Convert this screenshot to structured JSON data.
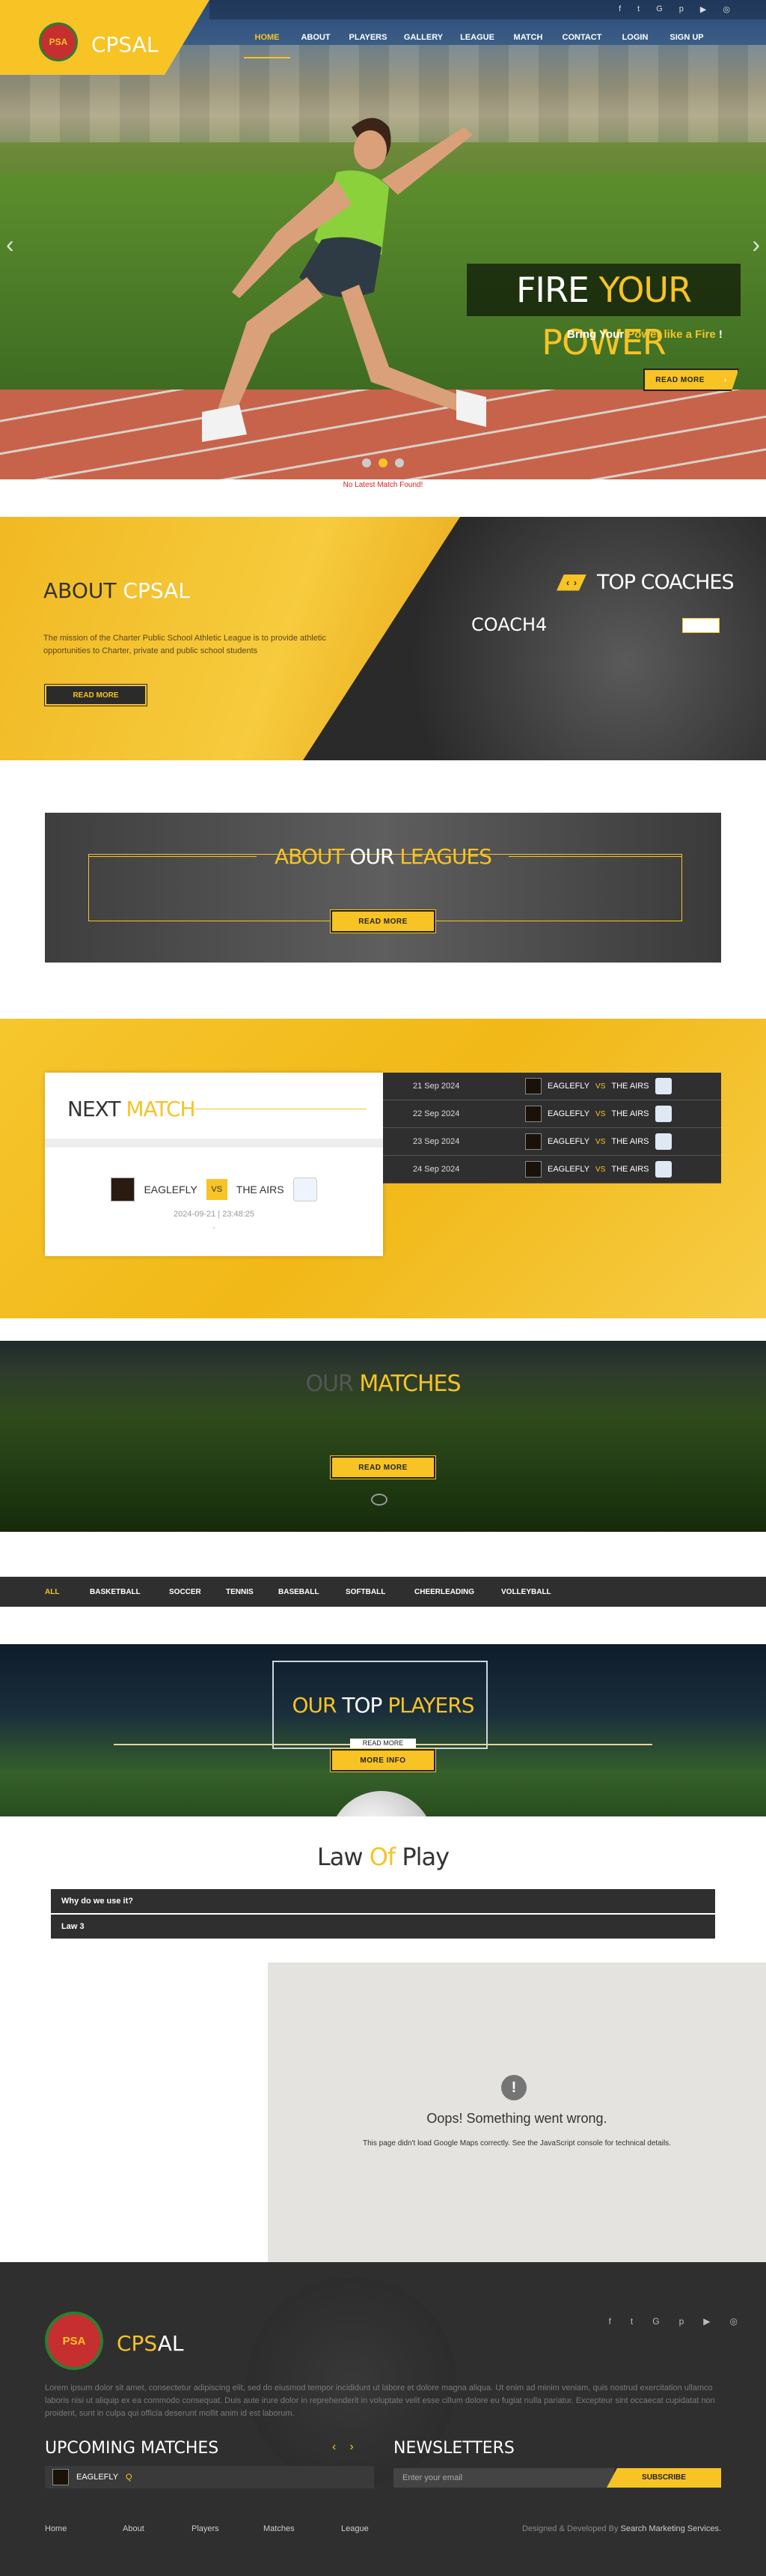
{
  "brand": {
    "name": "CPSAL",
    "logo_text": "PSA"
  },
  "topbar": {
    "social": [
      {
        "icon": "facebook-icon",
        "glyph": "f"
      },
      {
        "icon": "twitter-icon",
        "glyph": "t"
      },
      {
        "icon": "google-icon",
        "glyph": "G"
      },
      {
        "icon": "pinterest-icon",
        "glyph": "p"
      },
      {
        "icon": "youtube-icon",
        "glyph": "▶"
      },
      {
        "icon": "instagram-icon",
        "glyph": "◎"
      }
    ]
  },
  "nav": [
    {
      "label": "HOME",
      "active": true
    },
    {
      "label": "ABOUT"
    },
    {
      "label": "PLAYERS"
    },
    {
      "label": "GALLERY"
    },
    {
      "label": "LEAGUE"
    },
    {
      "label": "MATCH"
    },
    {
      "label": "CONTACT"
    },
    {
      "label": "LOGIN"
    },
    {
      "label": "SIGN UP"
    }
  ],
  "hero": {
    "title_white": "FIRE ",
    "title_yellow": "YOUR POWER",
    "sub_a": "Bring Your ",
    "sub_b": "Power like a Fire",
    "sub_c": " !",
    "button": "READ MORE",
    "prev": "‹",
    "next": "›",
    "no_match": "No Latest Match Found!"
  },
  "about": {
    "title_a": "ABOUT ",
    "title_b": "CPSAL",
    "text": "The mission of the Charter Public School Athletic League is to provide athletic opportunities to Charter, private and public school students",
    "button": "READ MORE"
  },
  "coaches": {
    "title": "TOP COACHES",
    "prev": "‹",
    "next": "›",
    "name": "COACH4"
  },
  "leagues": {
    "title_a": "ABOUT ",
    "title_b": "OUR ",
    "title_c": "LEAGUES",
    "button": "READ MORE"
  },
  "next_match": {
    "title_a": "NEXT ",
    "title_b": "MATCH",
    "team1": "EAGLEFLY",
    "vs": "VS",
    "team2": "THE AIRS",
    "date": "2024-09-21 | 23:48:25",
    "score": "-"
  },
  "schedule": [
    {
      "date": "21 Sep 2024",
      "team1": "EAGLEFLY",
      "vs": "VS",
      "team2": "THE AIRS"
    },
    {
      "date": "22 Sep 2024",
      "team1": "EAGLEFLY",
      "vs": "VS",
      "team2": "THE AIRS"
    },
    {
      "date": "23 Sep 2024",
      "team1": "EAGLEFLY",
      "vs": "VS",
      "team2": "THE AIRS"
    },
    {
      "date": "24 Sep 2024",
      "team1": "EAGLEFLY",
      "vs": "VS",
      "team2": "THE AIRS"
    }
  ],
  "matches": {
    "title_a": "OUR ",
    "title_b": "MATCHES",
    "button": "READ MORE"
  },
  "filters": [
    "ALL",
    "BASKETBALL",
    "SOCCER",
    "TENNIS",
    "BASEBALL",
    "SOFTBALL",
    "CHEERLEADING",
    "VOLLEYBALL"
  ],
  "players": {
    "title_a": "OUR ",
    "title_b": "TOP ",
    "title_c": "PLAYERS",
    "read_more": "READ MORE",
    "more_info": "MORE INFO"
  },
  "law": {
    "title_a": "Law ",
    "title_b": "Of ",
    "title_c": "Play",
    "items": [
      "Why do we use it?",
      "Law 3"
    ]
  },
  "map": {
    "icon": "!",
    "error": "Oops! Something went wrong.",
    "sub": "This page didn't load Google Maps correctly. See the JavaScript console for technical details."
  },
  "footer": {
    "name_a": "CPS",
    "name_b": "AL",
    "lorem": "Lorem ipsum dolor sit amet, consectetur adipiscing elit, sed do eiusmod tempor incididunt ut labore et dolore magna aliqua. Ut enim ad minim veniam, quis nostrud exercitation ullamco laboris nisi ut aliquip ex ea commodo consequat. Duis aute irure dolor in reprehenderit in voluptate velit esse cillum dolore eu fugiat nulla pariatur. Excepteur sint occaecat cupidatat non proident, sunt in culpa qui officia deserunt mollit anim id est laborum.",
    "upcoming_title": "UPCOMING MATCHES",
    "upcoming_prev": "‹",
    "upcoming_next": "›",
    "upcoming_team": "EAGLEFLY",
    "upcoming_vs": "Q",
    "news_title": "NEWSLETTERS",
    "email_placeholder": "Enter your email",
    "subscribe": "SUBSCRIBE",
    "links": [
      "Home",
      "About",
      "Players",
      "Matches",
      "League"
    ],
    "credit_a": "Designed & Developed By ",
    "credit_b": "Search Marketing Services."
  },
  "colors": {
    "accent": "#f7c325",
    "dark": "#2f2f2f"
  }
}
